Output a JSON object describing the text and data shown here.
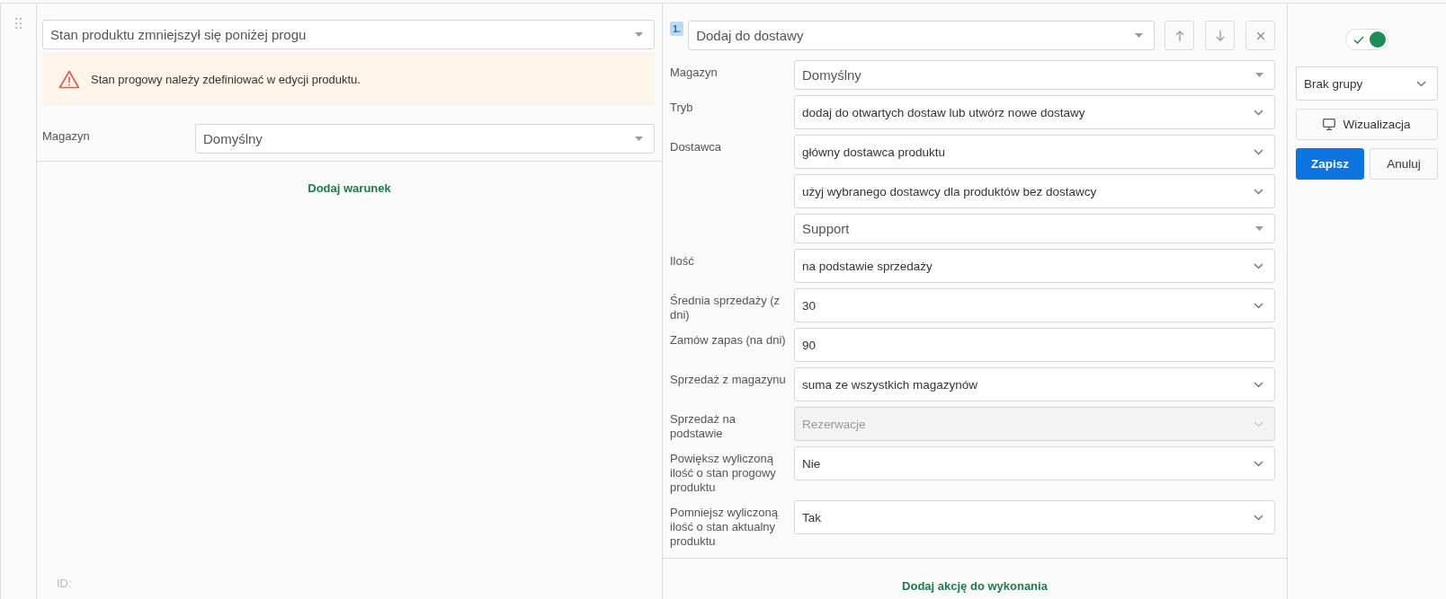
{
  "condition": {
    "trigger": {
      "kind": "dropdown",
      "value": "Stan produktu zmniejszył się poniżej progu"
    },
    "warning": "Stan progowy należy zdefiniować w edycji produktu.",
    "fields": [
      {
        "label": "Magazyn",
        "kind": "dropdown",
        "value": "Domyślny",
        "disabled": false
      }
    ],
    "add_link": "Dodaj warunek",
    "id_label": "ID:"
  },
  "action": {
    "number": "1.",
    "type": {
      "kind": "dropdown",
      "value": "Dodaj do dostawy"
    },
    "tools": [
      {
        "kind": "up"
      },
      {
        "kind": "down"
      },
      {
        "kind": "remove"
      }
    ],
    "fields": [
      {
        "label": "Magazyn",
        "kind": "dropdown",
        "value": "Domyślny",
        "disabled": false
      },
      {
        "label": "Tryb",
        "kind": "select",
        "value": "dodaj do otwartych dostaw lub utwórz nowe dostawy",
        "disabled": false
      },
      {
        "label": "Dostawca",
        "kind": "select",
        "value": "główny dostawca produktu",
        "disabled": false
      },
      {
        "kind": "select",
        "value": "użyj wybranego dostawcy dla produktów bez dostawcy",
        "disabled": false
      },
      {
        "kind": "dropdown",
        "value": "Support",
        "disabled": false
      },
      {
        "label": "Ilość",
        "kind": "select",
        "value": "na podstawie sprzedaży",
        "disabled": false
      },
      {
        "label": "Średnia sprzedaży (z dni)",
        "kind": "select",
        "value": "30",
        "disabled": false
      },
      {
        "label": "Zamów zapas (na dni)",
        "kind": "input",
        "value": "90",
        "disabled": false
      },
      {
        "label": "Sprzedaż z magazynu",
        "kind": "select",
        "value": "suma ze wszystkich magazynów",
        "disabled": false
      },
      {
        "label": "Sprzedaż na podstawie",
        "kind": "select",
        "value": "Rezerwacje",
        "disabled": true
      },
      {
        "label": "Powiększ wyliczoną ilość o stan progowy produktu",
        "kind": "select",
        "value": "Nie",
        "disabled": false
      },
      {
        "label": "Pomniejsz wyliczoną ilość o stan aktualny produktu",
        "kind": "select",
        "value": "Tak",
        "disabled": false
      }
    ],
    "add_link": "Dodaj akcję do wykonania"
  },
  "sidebar": {
    "enabled": true,
    "group": {
      "kind": "select",
      "value": "Brak grupy",
      "disabled": false
    },
    "visualize": "Wizualizacja",
    "save": "Zapisz",
    "cancel": "Anuluj"
  }
}
